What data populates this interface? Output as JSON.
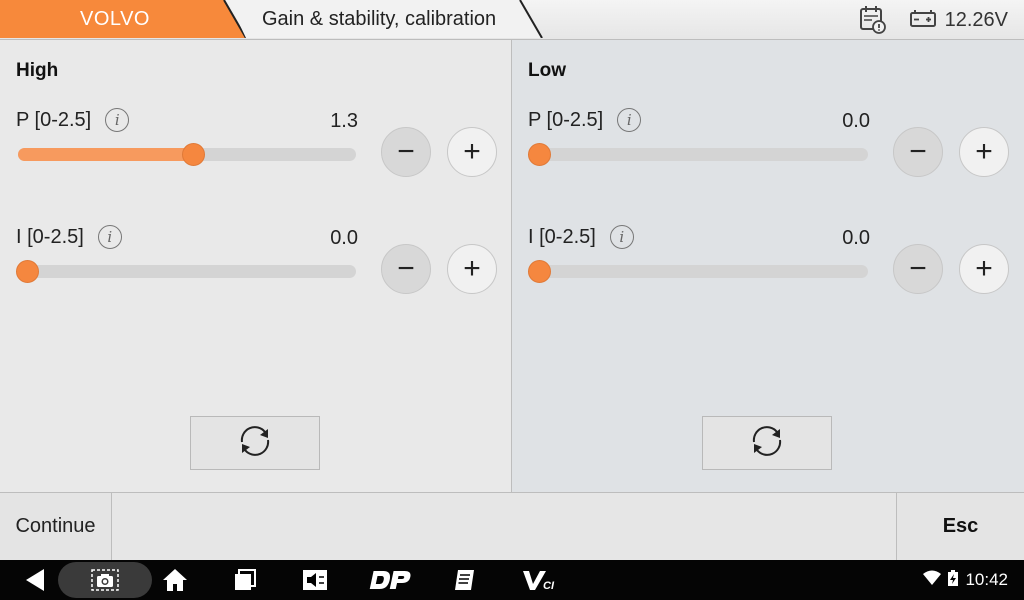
{
  "header": {
    "brand": "VOLVO",
    "title": "Gain & stability, calibration",
    "voltage": "12.26V",
    "colors": {
      "brand_tab": "#f7893b",
      "accent": "#f5873f"
    }
  },
  "panels": {
    "high": {
      "title": "High",
      "params": [
        {
          "label": "P [0-2.5]",
          "value": "1.3",
          "min": 0,
          "max": 2.5,
          "level": 1.3
        },
        {
          "label": "I [0-2.5]",
          "value": "0.0",
          "min": 0,
          "max": 2.5,
          "level": 0.0
        }
      ]
    },
    "low": {
      "title": "Low",
      "params": [
        {
          "label": "P [0-2.5]",
          "value": "0.0",
          "min": 0,
          "max": 2.5,
          "level": 0.0
        },
        {
          "label": "I [0-2.5]",
          "value": "0.0",
          "min": 0,
          "max": 2.5,
          "level": 0.0
        }
      ]
    }
  },
  "buttons": {
    "minus": "−",
    "plus": "+",
    "info": "i",
    "continue": "Continue",
    "esc": "Esc"
  },
  "status_bar": {
    "time": "10:42"
  },
  "icons": [
    "calendar-alert-icon",
    "battery-icon",
    "info-icon",
    "refresh-icon",
    "back-icon",
    "screenshot-icon",
    "home-icon",
    "recent-apps-icon",
    "media-icon",
    "dp-icon",
    "notes-icon",
    "vci-icon",
    "wifi-icon",
    "battery-charging-icon"
  ]
}
